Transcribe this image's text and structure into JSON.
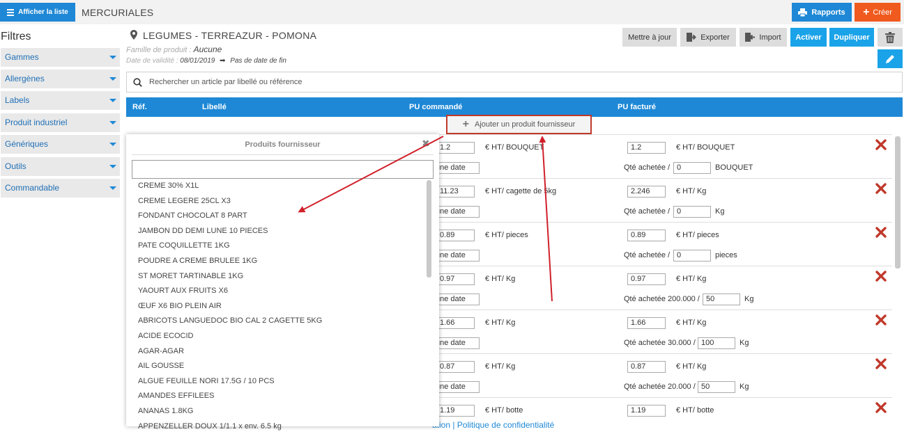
{
  "topbar": {
    "show_list_label": "Afficher la liste",
    "title": "MERCURIALES",
    "reports_label": "Rapports",
    "create_label": "Créer",
    "create_color": "#f05a1e",
    "accent_color": "#1e88d6"
  },
  "sidebar": {
    "title": "Filtres",
    "items": [
      {
        "label": "Gammes"
      },
      {
        "label": "Allergènes"
      },
      {
        "label": "Labels"
      },
      {
        "label": "Produit industriel"
      },
      {
        "label": "Génériques"
      },
      {
        "label": "Outils"
      },
      {
        "label": "Commandable"
      }
    ]
  },
  "mercuriale": {
    "title": "LEGUMES - TERREAZUR - POMONA",
    "family_label": "Famille de produit :",
    "family_value": "Aucune",
    "validity_label": "Date de validité :",
    "validity_start": "08/01/2019",
    "validity_end": "Pas de date de fin"
  },
  "actions": {
    "mettre_a_jour": "Mettre à jour",
    "exporter": "Exporter",
    "import": "Import",
    "activer": "Activer",
    "dupliquer": "Dupliquer"
  },
  "search": {
    "placeholder": "Rechercher un article par libellé ou référence"
  },
  "table": {
    "headers": {
      "ref": "Réf.",
      "libelle": "Libellé",
      "pu_commande": "PU commandé",
      "pu_facture": "PU facturé"
    },
    "add_label": "Ajouter un produit fournisseur",
    "rows": [
      {
        "pu_cmd": "1.2",
        "unit_cmd": "€ HT/ BOUQUET",
        "date": "une date",
        "pu_fac": "1.2",
        "unit_fac": "€ HT/ BOUQUET",
        "qte_label": "Qté achetée /",
        "qte": "0",
        "qte_unit": "BOUQUET"
      },
      {
        "pu_cmd": "11.23",
        "unit_cmd": "€ HT/ cagette de 5kg",
        "date": "une date",
        "pu_fac": "2.246",
        "unit_fac": "€ HT/ Kg",
        "qte_label": "Qté achetée /",
        "qte": "0",
        "qte_unit": "Kg"
      },
      {
        "pu_cmd": "0.89",
        "unit_cmd": "€ HT/ pieces",
        "date": "une date",
        "pu_fac": "0.89",
        "unit_fac": "€ HT/ pieces",
        "qte_label": "Qté achetée /",
        "qte": "0",
        "qte_unit": "pieces"
      },
      {
        "pu_cmd": "0.97",
        "unit_cmd": "€ HT/ Kg",
        "date": "une date",
        "pu_fac": "0.97",
        "unit_fac": "€ HT/ Kg",
        "qte_label": "Qté achetée 200.000 /",
        "qte": "50",
        "qte_unit": "Kg"
      },
      {
        "pu_cmd": "1.66",
        "unit_cmd": "€ HT/ Kg",
        "date": "une date",
        "pu_fac": "1.66",
        "unit_fac": "€ HT/ Kg",
        "qte_label": "Qté achetée 30.000 /",
        "qte": "100",
        "qte_unit": "Kg"
      },
      {
        "pu_cmd": "0.87",
        "unit_cmd": "€ HT/ Kg",
        "date": "une date",
        "pu_fac": "0.87",
        "unit_fac": "€ HT/ Kg",
        "qte_label": "Qté achetée 20.000 /",
        "qte": "50",
        "qte_unit": "Kg"
      },
      {
        "pu_cmd": "1.19",
        "unit_cmd": "€ HT/ botte",
        "date": "",
        "pu_fac": "1.19",
        "unit_fac": "€ HT/ botte",
        "qte_label": "",
        "qte": "",
        "qte_unit": ""
      }
    ]
  },
  "supplier_panel": {
    "title": "Produits fournisseur",
    "products": [
      "CREME 30% X1L",
      "CREME LEGERE 25CL X3",
      "FONDANT CHOCOLAT 8 PART",
      "JAMBON DD DEMI LUNE 10 PIECES",
      "PATE COQUILLETTE 1KG",
      "POUDRE A CREME BRULEE 1KG",
      "ST MORET TARTINABLE 1KG",
      "YAOURT AUX FRUITS X6",
      "ŒUF X6 BIO PLEIN AIR",
      "ABRICOTS LANGUEDOC BIO CAL 2 CAGETTE 5KG",
      "ACIDE ECOCID",
      "AGAR-AGAR",
      "AIL GOUSSE",
      "ALGUE FEUILLE NORI 17.5G / 10 PCS",
      "AMANDES EFFILEES",
      "ANANAS 1.8KG",
      "APPENZELLER DOUX 1/1.1 x env. 6.5 kg"
    ]
  },
  "footer": {
    "text": "ation  |  Politique de confidentialité"
  },
  "annotation_color": "#d0202a"
}
